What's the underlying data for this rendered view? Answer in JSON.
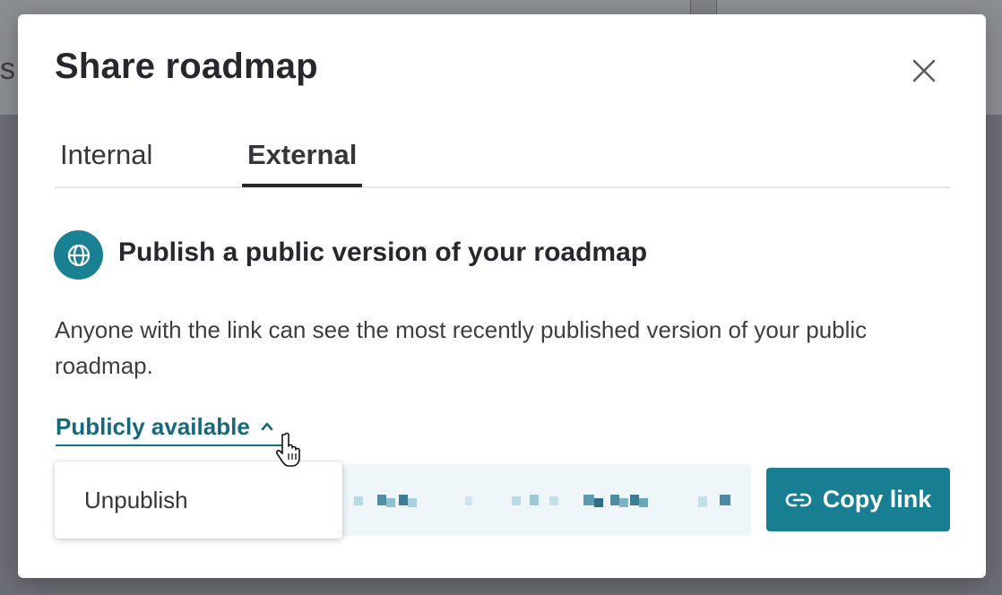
{
  "background": {
    "partial_letter": "s"
  },
  "modal": {
    "title": "Share roadmap",
    "close_icon": "close-icon"
  },
  "tabs": [
    {
      "label": "Internal",
      "active": false
    },
    {
      "label": "External",
      "active": true
    }
  ],
  "publish": {
    "icon": "globe-icon",
    "heading": "Publish a public version of your roadmap",
    "description": "Anyone with the link can see the most recently published version of your public roadmap.",
    "status_label": "Publicly available",
    "status_icon": "chevron-up-icon",
    "link_value_obscured": true,
    "copy_button_label": "Copy link",
    "copy_button_icon": "link-icon"
  },
  "dropdown": {
    "items": [
      {
        "label": "Unpublish"
      }
    ]
  },
  "colors": {
    "accent": "#177f91",
    "accent_text": "#16697a",
    "title_text": "#26282d",
    "link_field_bg": "#eef6fa",
    "backdrop": "#6b6e74"
  }
}
